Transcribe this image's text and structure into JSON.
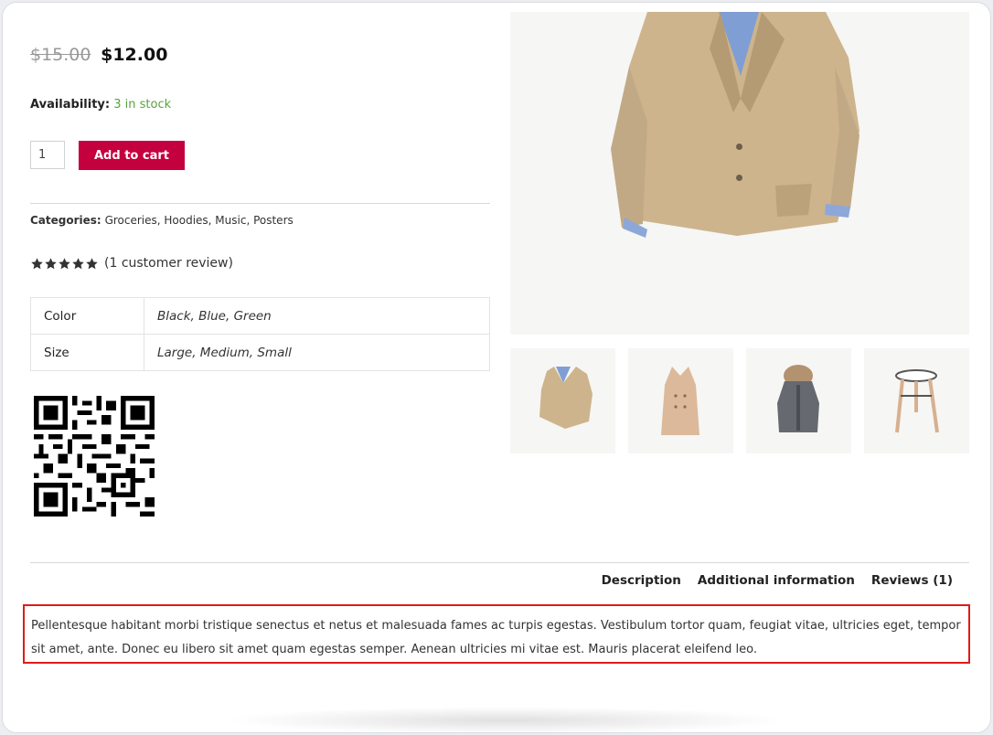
{
  "product": {
    "old_price": "$15.00",
    "new_price": "$12.00",
    "availability_label": "Availability:",
    "availability_value": "3 in stock",
    "quantity": "1",
    "add_to_cart": "Add to cart",
    "categories_label": "Categories:",
    "categories": "Groceries, Hoodies, Music, Posters",
    "rating": 5,
    "review_text": "(1 customer review)"
  },
  "attributes": [
    {
      "key": "Color",
      "value": "Black, Blue, Green"
    },
    {
      "key": "Size",
      "value": "Large, Medium, Small"
    }
  ],
  "gallery": {
    "main": "jacket",
    "thumbs": [
      "jacket",
      "coat",
      "parka",
      "stool"
    ]
  },
  "tabs": [
    "Description",
    "Additional information",
    "Reviews (1)"
  ],
  "description": "Pellentesque habitant morbi tristique senectus et netus et malesuada fames ac turpis egestas. Vestibulum tortor quam, feugiat vitae, ultricies eget, tempor sit amet, ante. Donec eu libero sit amet quam egestas semper. Aenean ultricies mi vitae est. Mauris placerat eleifend leo.",
  "colors": {
    "accent": "#c4003e",
    "in_stock": "#58a33a",
    "highlight": "#e01b1b"
  }
}
